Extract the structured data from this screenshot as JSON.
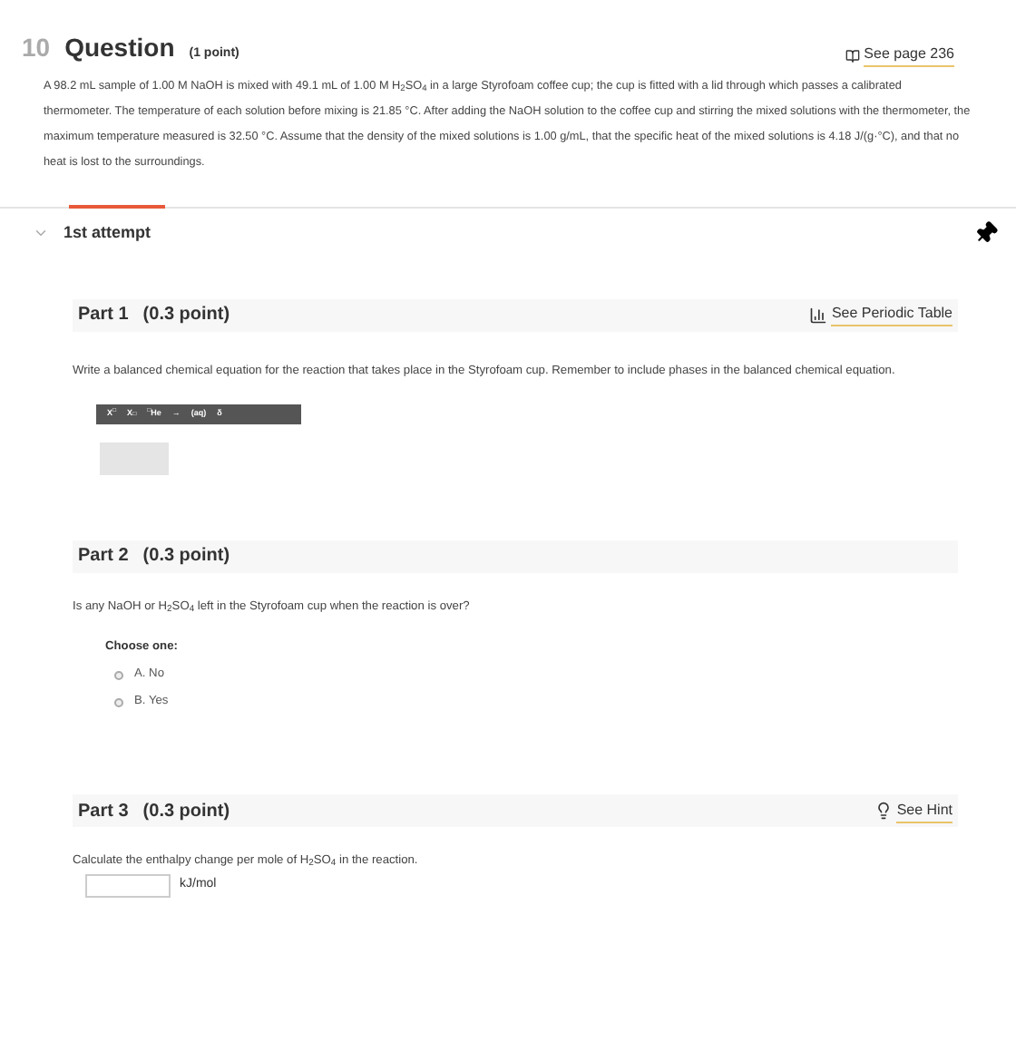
{
  "question": {
    "number": "10",
    "title": "Question",
    "points": "(1 point)",
    "link": "See page 236",
    "text": "A 98.2 mL sample of 1.00 M NaOH is mixed with 49.1  mL of 1.00 M H$_{2}$SO$_{4}$ in a large Styrofoam coffee cup; the cup is fitted with a lid through which passes a calibrated thermometer. The temperature of each solution before mixing is 21.85 °C. After adding the NaOH solution to the coffee cup and stirring the mixed solutions with the thermometer, the maximum temperature measured is 32.50 °C. Assume that the density of the mixed solutions is 1.00 g/mL, that the specific heat of the mixed solutions is 4.18 J/(g·°C), and that no heat is lost to the surroundings."
  },
  "attempt": {
    "label": "1st attempt",
    "expanded": true
  },
  "parts": [
    {
      "kind": "equation",
      "title": "Part 1",
      "points": "(0.3 point)",
      "link": "See Periodic Table",
      "prompt": "Write a balanced chemical equation for the reaction that takes place in the Styrofoam cup. Remember to include phases in the balanced chemical equation.",
      "toolbar": [
        "X$^{□}$",
        "X$_{□}$",
        "$^{□}$He",
        "→",
        "(aq)",
        "δ"
      ]
    },
    {
      "kind": "choice",
      "title": "Part 2",
      "points": "(0.3 point)",
      "prompt": "Is any NaOH or H$_{2}$SO$_{4}$ left in the Styrofoam cup when the reaction is over?",
      "choose_label": "Choose one:",
      "options": [
        {
          "label": "A.  No",
          "selected": false
        },
        {
          "label": "B.  Yes",
          "selected": false
        }
      ]
    },
    {
      "kind": "numeric",
      "title": "Part 3",
      "points": "(0.3 point)",
      "link": "See Hint",
      "prompt": "Calculate the enthalpy change per mole of H$_{2}$SO$_{4}$ in the reaction.",
      "unit": "kJ/mol"
    }
  ]
}
